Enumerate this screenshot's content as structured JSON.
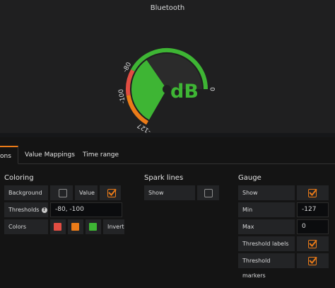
{
  "panel": {
    "title": "Bluetooth",
    "gauge": {
      "value_text": "66 dB",
      "value": -66,
      "min": -127,
      "max": 0,
      "min_label": "-127",
      "max_label": "0",
      "thresholds": [
        -100,
        -80
      ],
      "threshold_labels": [
        "-100",
        "-80"
      ],
      "colors": {
        "low": "#eb7b18",
        "mid": "#e24d42",
        "high": "#3eb534",
        "track": "#2b2b2b"
      }
    }
  },
  "tabs": [
    {
      "label": "ons"
    },
    {
      "label": "Value Mappings"
    },
    {
      "label": "Time range"
    }
  ],
  "coloring": {
    "title": "Coloring",
    "background_label": "Background",
    "background_checked": false,
    "value_label": "Value",
    "value_checked": true,
    "thresholds_label": "Thresholds",
    "thresholds_value": "-80, -100",
    "colors_label": "Colors",
    "swatches": [
      "#e24d42",
      "#eb7b18",
      "#3eb534"
    ],
    "invert_label": "Invert"
  },
  "spark": {
    "title": "Spark lines",
    "show_label": "Show",
    "show_checked": false
  },
  "gauge_opts": {
    "title": "Gauge",
    "show_label": "Show",
    "show_checked": true,
    "min_label": "Min",
    "min_value": "-127",
    "max_label": "Max",
    "max_value": "0",
    "threshold_labels_label": "Threshold labels",
    "threshold_labels_checked": true,
    "threshold_markers_label": "Threshold markers",
    "threshold_markers_checked": true
  },
  "colors": {
    "accent": "#eb7b18",
    "panel_bg": "#1f1f20",
    "cell_bg": "#232426"
  }
}
